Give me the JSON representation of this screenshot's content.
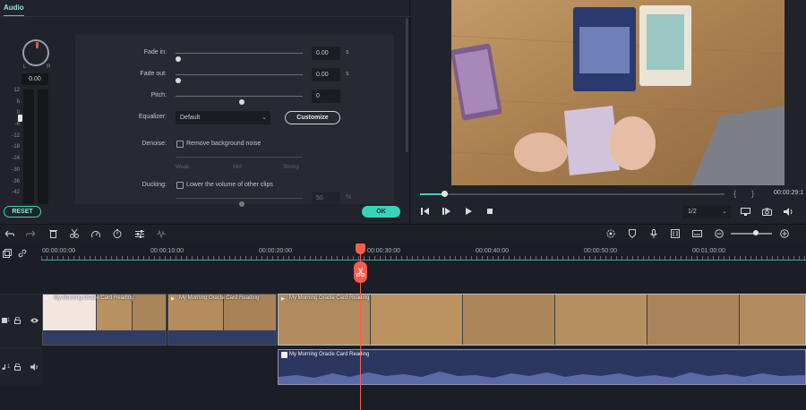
{
  "audio_panel": {
    "tab": "Audio",
    "knob": {
      "left_label": "L",
      "right_label": "R",
      "value": "0.00"
    },
    "meter_scale": [
      "12",
      "6",
      "0",
      "-6",
      "-12",
      "-18",
      "-24",
      "-30",
      "-36",
      "-42",
      "-48",
      "-54",
      "-60"
    ],
    "fade_in": {
      "label": "Fade in:",
      "value": "0.00",
      "unit": "s",
      "level": 0
    },
    "fade_out": {
      "label": "Fade out:",
      "value": "0.00",
      "unit": "s",
      "level": 0
    },
    "pitch": {
      "label": "Pitch:",
      "value": "0",
      "level": 0.5
    },
    "equalizer": {
      "label": "Equalizer:",
      "selected": "Default",
      "customize": "Customize"
    },
    "denoise": {
      "label": "Denoise:",
      "checkbox": "Remove background noise",
      "scale": [
        "Weak",
        "Mid",
        "Strong"
      ]
    },
    "ducking": {
      "label": "Ducking:",
      "checkbox": "Lower the volume of other clips",
      "value": "50",
      "unit": "%",
      "level": 0.5
    },
    "reset": "RESET",
    "ok": "OK"
  },
  "preview": {
    "timecode": "00:00:29:1",
    "progress": 0.08,
    "brace_left": "{",
    "brace_right": "}",
    "quality": "1/2"
  },
  "timeline": {
    "ruler": [
      "00:00:00:00",
      "00:00:10:00",
      "00:00:20:00",
      "00:00:30:00",
      "00:00:40:00",
      "00:00:50:00",
      "00:01:00:00"
    ],
    "video_track_number": "1",
    "audio_track_number": "1",
    "clips": [
      {
        "title": "My Morning Oracle Card Reading"
      },
      {
        "title": "My Morning Oracle Card Reading"
      },
      {
        "title": "My Morning Oracle Card Reading"
      }
    ],
    "audio_clip": {
      "title": "My Morning Oracle Card Reading"
    }
  },
  "colors": {
    "accent": "#3bd2bc",
    "playhead": "#ff5b4d",
    "panel": "#202329"
  }
}
